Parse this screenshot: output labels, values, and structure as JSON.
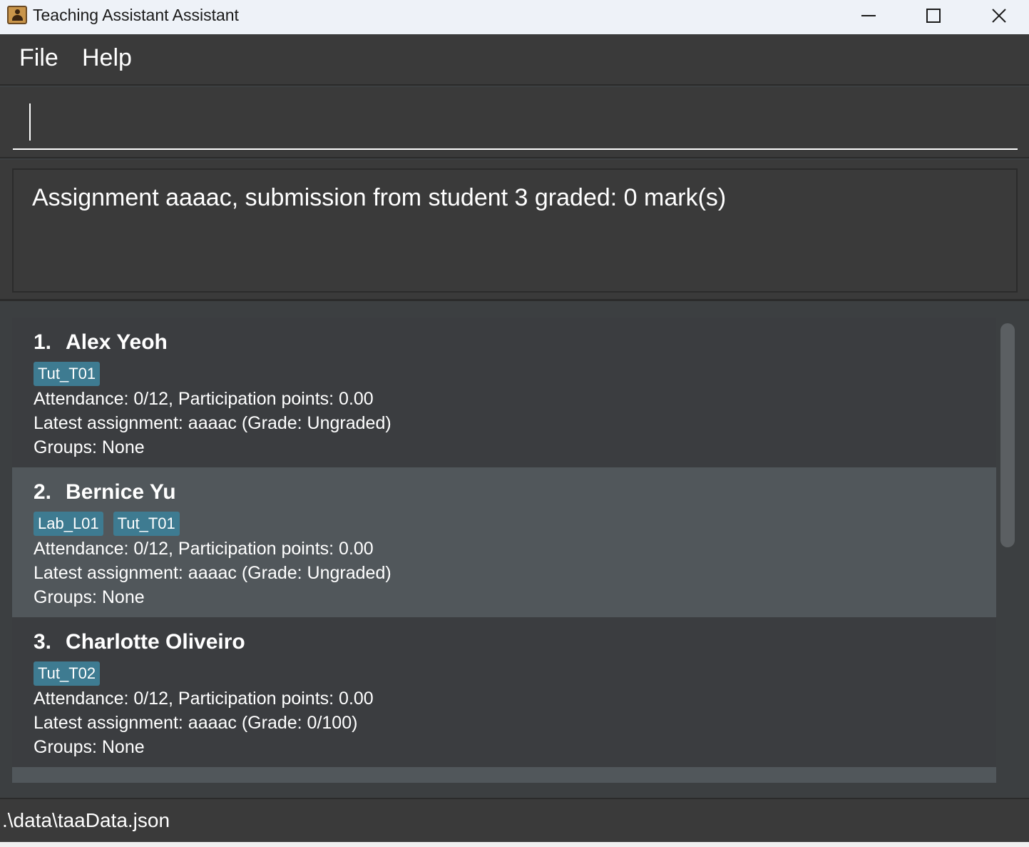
{
  "window": {
    "title": "Teaching Assistant Assistant",
    "icon": "address-book-icon"
  },
  "menu": {
    "file": "File",
    "help": "Help"
  },
  "command": {
    "value": "",
    "placeholder": ""
  },
  "result": {
    "message": "Assignment aaaac, submission from student 3 graded: 0 mark(s)"
  },
  "students": [
    {
      "index": "1.",
      "name": "Alex Yeoh",
      "tags": [
        "Tut_T01"
      ],
      "attendance": "Attendance: 0/12, Participation points: 0.00",
      "assignment": "Latest assignment: aaaac (Grade: Ungraded)",
      "groups": "Groups: None"
    },
    {
      "index": "2.",
      "name": "Bernice Yu",
      "tags": [
        "Lab_L01",
        "Tut_T01"
      ],
      "attendance": "Attendance: 0/12, Participation points: 0.00",
      "assignment": "Latest assignment: aaaac (Grade: Ungraded)",
      "groups": "Groups: None"
    },
    {
      "index": "3.",
      "name": "Charlotte Oliveiro",
      "tags": [
        "Tut_T02"
      ],
      "attendance": "Attendance: 0/12, Participation points: 0.00",
      "assignment": "Latest assignment: aaaac (Grade: 0/100)",
      "groups": "Groups: None"
    }
  ],
  "status": {
    "path": ".\\data\\taaData.json"
  },
  "colors": {
    "tag": "#3e7b91",
    "card_alt": "#51575b",
    "background": "#3c3f41"
  }
}
